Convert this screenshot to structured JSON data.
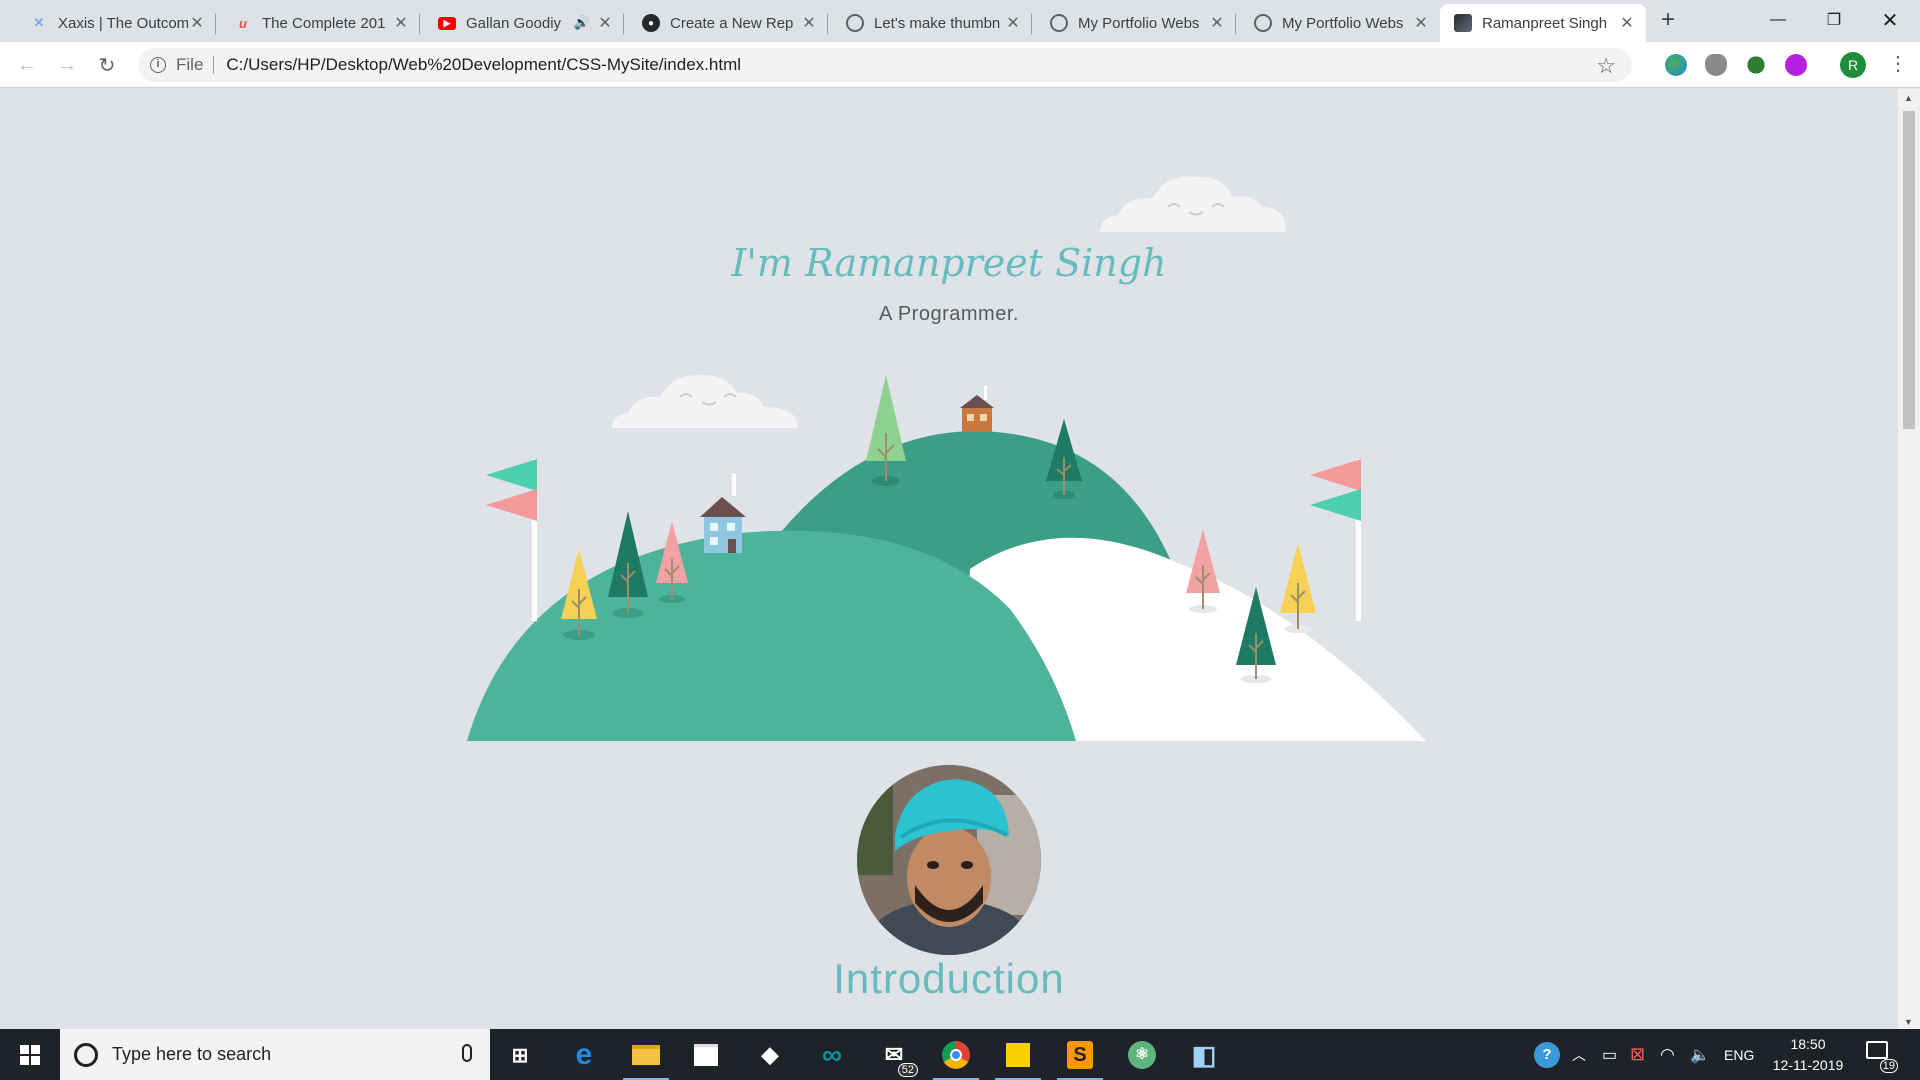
{
  "browser": {
    "tabs": [
      {
        "title": "Xaxis | The Outcom",
        "favicon": "xaxis-icon",
        "fav_color": "#7aa7d9"
      },
      {
        "title": "The Complete 201",
        "favicon": "udemy-icon",
        "fav_color": "#ec5252"
      },
      {
        "title": "Gallan Goodiy",
        "favicon": "youtube-icon",
        "fav_color": "#ff0000"
      },
      {
        "title": "Create a New Rep",
        "favicon": "github-icon",
        "fav_color": "#24292e"
      },
      {
        "title": "Let's make thumbn",
        "favicon": "globe-icon",
        "fav_color": "#5f6368"
      },
      {
        "title": "My Portfolio Webs",
        "favicon": "globe-icon",
        "fav_color": "#5f6368"
      },
      {
        "title": "My Portfolio Webs",
        "favicon": "globe-icon",
        "fav_color": "#5f6368"
      },
      {
        "title": "Ramanpreet Singh",
        "favicon": "site-thumbnail-icon",
        "fav_color": "#3a3a3a",
        "active": true
      }
    ],
    "address": {
      "scheme_label": "File",
      "url": "C:/Users/HP/Desktop/Web%20Development/CSS-MySite/index.html"
    },
    "profile_initial": "R"
  },
  "page": {
    "hero_name": "I'm Ramanpreet Singh",
    "hero_subtitle": "A Programmer.",
    "section_title": "Introduction",
    "colors": {
      "background": "#dfe3e8",
      "accent": "#66bcbc",
      "hill_back": "#3b9e86",
      "hill_front": "#4db39a",
      "hill_snow": "#ffffff",
      "tree_dark": "#1e7a63",
      "tree_light": "#8fd18e",
      "tree_pink": "#f2a2a2",
      "tree_yellow": "#f7d154",
      "flag_green": "#4ccfae",
      "flag_pink": "#f39a9a"
    }
  },
  "taskbar": {
    "search_placeholder": "Type here to search",
    "mail_badge": "52",
    "language": "ENG",
    "time": "18:50",
    "date": "12-11-2019",
    "notification_count": "19"
  }
}
